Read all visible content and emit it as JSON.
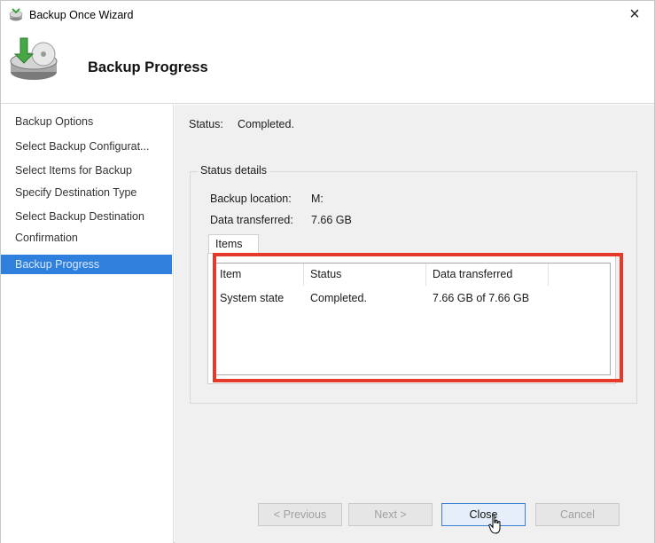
{
  "window": {
    "title": "Backup Once Wizard",
    "close_glyph": "×"
  },
  "header": {
    "title": "Backup Progress",
    "icon": "backup-drive-icon"
  },
  "sidebar": {
    "items": [
      {
        "label": "Backup Options",
        "active": false
      },
      {
        "label": "Select Backup Configurat...",
        "active": false
      },
      {
        "label": "Select Items for Backup",
        "active": false
      },
      {
        "label": "Specify Destination Type",
        "active": false
      },
      {
        "label": "Select Backup Destination",
        "active": false
      },
      {
        "label": "Confirmation",
        "active": false
      },
      {
        "label": "Backup Progress",
        "active": true
      }
    ]
  },
  "status": {
    "label": "Status:",
    "value": "Completed."
  },
  "details": {
    "legend": "Status details",
    "backup_location_label": "Backup location:",
    "backup_location_value": "M:",
    "data_transferred_label": "Data transferred:",
    "data_transferred_value": "7.66 GB"
  },
  "items_tab": {
    "label": "Items",
    "columns": [
      "Item",
      "Status",
      "Data transferred"
    ],
    "rows": [
      [
        "System state",
        "Completed.",
        "7.66 GB of 7.66 GB"
      ]
    ]
  },
  "buttons": {
    "previous": "< Previous",
    "next": "Next >",
    "close": "Close",
    "cancel": "Cancel"
  },
  "colors": {
    "accent": "#2f80dd",
    "highlight_box": "#e53a2a"
  }
}
